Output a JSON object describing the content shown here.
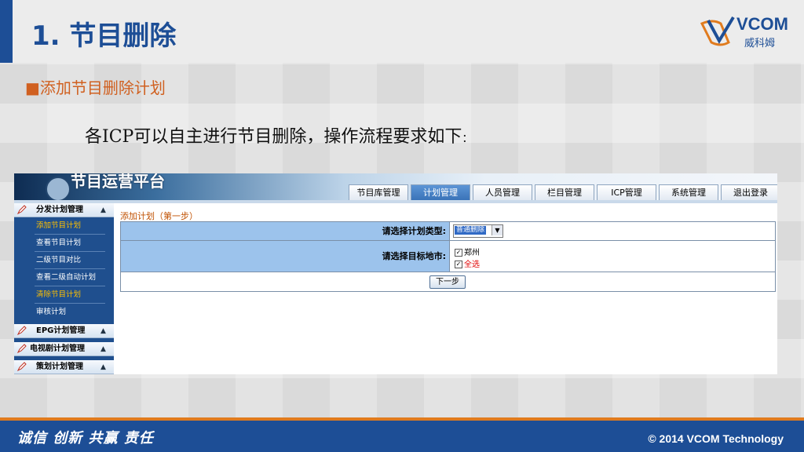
{
  "slide": {
    "title": "1. 节目删除",
    "logo_text": "VCOM",
    "logo_sub": "威科姆",
    "section_square": "■",
    "section_head": "添加节目删除计划",
    "intro_main": "各ICP可以自主进行节目删除，操作流程要求如下",
    "intro_end": "："
  },
  "app": {
    "brand": "节目运营平台",
    "tabs": [
      {
        "label": "节目库管理"
      },
      {
        "label": "计划管理"
      },
      {
        "label": "人员管理"
      },
      {
        "label": "栏目管理"
      },
      {
        "label": "ICP管理"
      },
      {
        "label": "系统管理"
      },
      {
        "label": "退出登录"
      }
    ],
    "sidebar": {
      "groups": [
        {
          "label": "分发计划管理"
        },
        {
          "label": "EPG计划管理"
        },
        {
          "label": "电视剧计划管理"
        },
        {
          "label": "策划计划管理"
        }
      ],
      "items": [
        {
          "label": "添加节目计划"
        },
        {
          "label": "查看节目计划"
        },
        {
          "label": "二级节目对比"
        },
        {
          "label": "查看二级自动计划"
        },
        {
          "label": "清除节目计划"
        },
        {
          "label": "审核计划"
        }
      ]
    },
    "form": {
      "step_title": "添加计划（第一步）",
      "plan_type_label": "请选择计划类型:",
      "plan_type_value": "普通删除",
      "target_label": "请选择目标地市:",
      "target_option": "郑州",
      "select_all": "全选",
      "check_mark": "✓",
      "next_label": "下一步"
    }
  },
  "footer": {
    "motto": "诚信 创新 共赢 责任",
    "copyright": "© 2014 VCOM Technology"
  },
  "colors": {
    "primary": "#1d4e96",
    "accent": "#e07b1e",
    "highlight": "#ffc000"
  }
}
